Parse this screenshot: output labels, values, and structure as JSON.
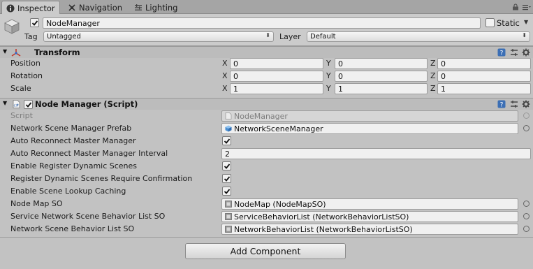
{
  "tabs": [
    {
      "label": "Inspector",
      "icon": "info-icon"
    },
    {
      "label": "Navigation",
      "icon": "navigation-icon"
    },
    {
      "label": "Lighting",
      "icon": "lighting-icon"
    }
  ],
  "header": {
    "object_name": "NodeManager",
    "static_label": "Static",
    "tag_label": "Tag",
    "tag_value": "Untagged",
    "layer_label": "Layer",
    "layer_value": "Default"
  },
  "transform": {
    "title": "Transform",
    "rows": [
      {
        "label": "Position",
        "x": "0",
        "y": "0",
        "z": "0"
      },
      {
        "label": "Rotation",
        "x": "0",
        "y": "0",
        "z": "0"
      },
      {
        "label": "Scale",
        "x": "1",
        "y": "1",
        "z": "1"
      }
    ],
    "axis_x": "X",
    "axis_y": "Y",
    "axis_z": "Z"
  },
  "node_manager": {
    "title": "Node Manager (Script)",
    "script_label": "Script",
    "script_value": "NodeManager",
    "fields": {
      "prefab_label": "Network Scene Manager Prefab",
      "prefab_value": "NetworkSceneManager",
      "auto_reconnect_label": "Auto Reconnect Master Manager",
      "auto_reconnect_interval_label": "Auto Reconnect Master Manager Interval",
      "auto_reconnect_interval_value": "2",
      "enable_register_label": "Enable Register Dynamic Scenes",
      "register_confirm_label": "Register Dynamic Scenes Require Confirmation",
      "scene_lookup_label": "Enable Scene Lookup Caching",
      "node_map_label": "Node Map SO",
      "node_map_value": "NodeMap (NodeMapSO)",
      "service_list_label": "Service Network Scene Behavior List SO",
      "service_list_value": "ServiceBehaviorList (NetworkBehaviorListSO)",
      "network_list_label": "Network Scene Behavior List SO",
      "network_list_value": "NetworkBehaviorList (NetworkBehaviorListSO)"
    }
  },
  "add_component_label": "Add Component"
}
